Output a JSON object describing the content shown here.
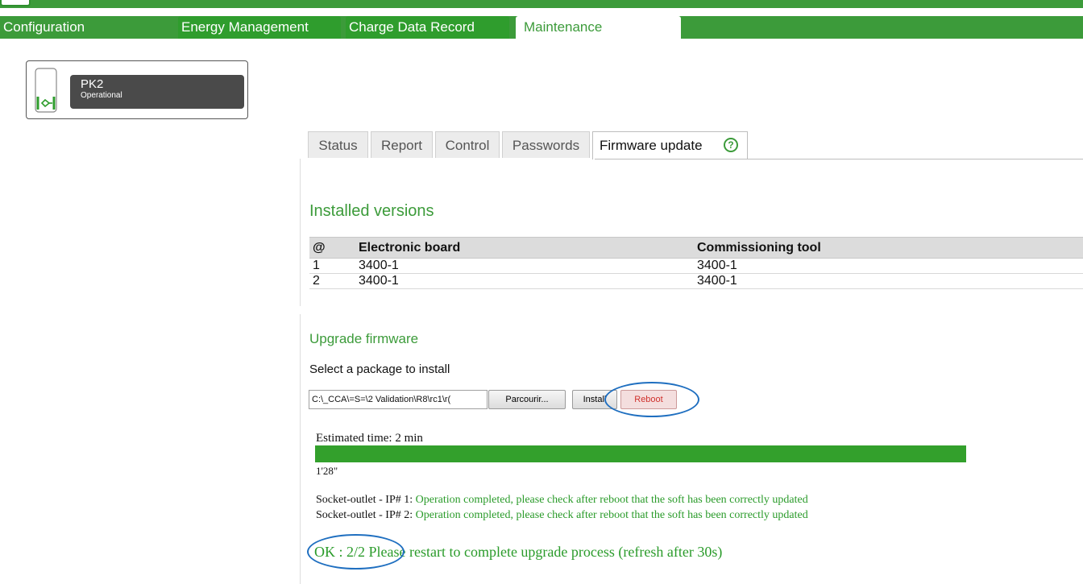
{
  "nav": {
    "tabs": [
      {
        "label": "Configuration"
      },
      {
        "label": "Energy Management"
      },
      {
        "label": "Charge Data Record"
      },
      {
        "label": "Maintenance"
      }
    ],
    "active_tab": "Maintenance"
  },
  "device": {
    "name": "PK2",
    "status": "Operational",
    "icon": "charging-station-icon",
    "accent_color": "#2f9d2d"
  },
  "subtabs": {
    "items": [
      {
        "label": "Status"
      },
      {
        "label": "Report"
      },
      {
        "label": "Control"
      },
      {
        "label": "Passwords"
      },
      {
        "label": "Firmware update"
      }
    ],
    "active": "Firmware update",
    "help_icon": "help-circle-icon"
  },
  "installed": {
    "title": "Installed versions",
    "columns": [
      "@",
      "Electronic board",
      "Commissioning tool"
    ],
    "rows": [
      [
        "1",
        "3400-1",
        "3400-1"
      ],
      [
        "2",
        "3400-1",
        "3400-1"
      ]
    ]
  },
  "upgrade": {
    "title": "Upgrade firmware",
    "select_label": "Select a package to install",
    "file_path": "C:\\_CCA\\=S=\\2 Validation\\R8\\rc1\\r(",
    "browse_label": "Parcourir...",
    "install_label": "Install",
    "reboot_label": "Reboot",
    "estimated_time": "Estimated time: 2 min",
    "progress": 1.0,
    "elapsed": "1'28\"",
    "messages": [
      {
        "prefix": "Socket-outlet - IP# 1: ",
        "text": "Operation completed, please check after reboot that the soft has been correctly updated"
      },
      {
        "prefix": "Socket-outlet - IP# 2: ",
        "text": "Operation completed, please check after reboot that the soft has been correctly updated"
      }
    ],
    "final_message": "OK : 2/2 Please restart to complete upgrade process (refresh after 30s)"
  },
  "colors": {
    "brand_green": "#3c9b3a",
    "progress_green": "#33a02c",
    "annotation_blue": "#1f6fc0",
    "reboot_red": "#d0312d"
  }
}
